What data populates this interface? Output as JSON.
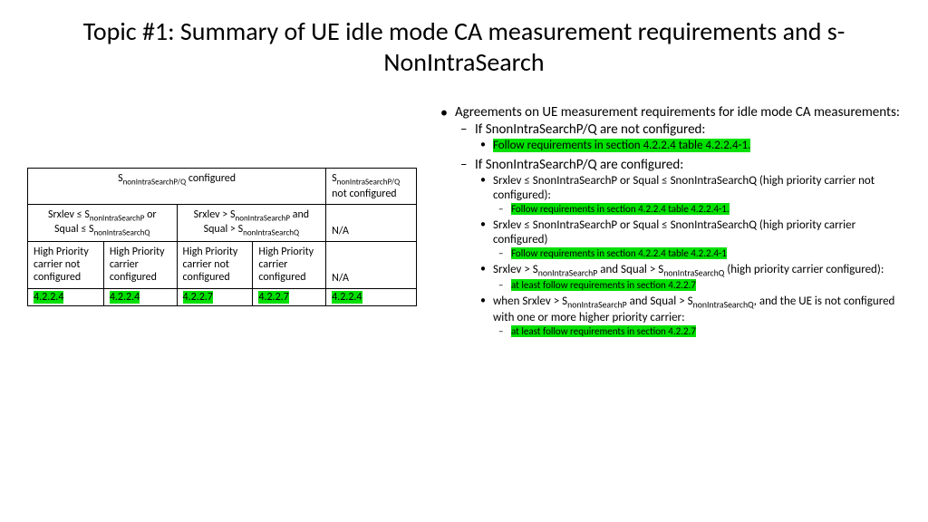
{
  "title": "Topic #1: Summary of UE idle mode CA measurement requirements and s-NonIntraSearch",
  "table": {
    "h_configured_pre": "S",
    "h_configured_sub": "nonIntraSearchP/Q",
    "h_configured_post": " configured",
    "h_notconf_pre": "S",
    "h_notconf_sub": "nonIntraSearchP/Q",
    "h_notconf_post": " not configured",
    "cond1_l1_pre": "Srxlev ≤ S",
    "cond1_l1_sub": "nonIntraSearchP",
    "cond1_l1_post": " or",
    "cond1_l2_pre": "Squal ≤ S",
    "cond1_l2_sub": "nonIntraSearchQ",
    "cond2_l1_pre": "Srxlev > S",
    "cond2_l1_sub": "nonIntraSearchP",
    "cond2_l1_post": " and",
    "cond2_l2_pre": "Squal > S",
    "cond2_l2_sub": "nonIntraSearchQ",
    "na": "N/A",
    "c1": "High Priority carrier not configured",
    "c2": "High Priority carrier configured",
    "c3": "High Priority carrier not configured",
    "c4": "High Priority carrier configured",
    "v1": "4.2.2.4",
    "v2": "4.2.2.4",
    "v3": "4.2.2.7",
    "v4": "4.2.2.7",
    "v5": "4.2.2.4"
  },
  "bul": {
    "a": "Agreements on UE measurement requirements for idle mode CA measurements:",
    "b1": "If SnonIntraSearchP/Q are not configured:",
    "b1a": "Follow requirements in section 4.2.2.4 table 4.2.2.4-1.",
    "b2": "If SnonIntraSearchP/Q are configured:",
    "b2a": "Srxlev ≤ SnonIntraSearchP or Squal ≤ SnonIntraSearchQ (high priority carrier not configured):",
    "b2a1": "Follow requirements in section 4.2.2.4 table 4.2.2.4-1.",
    "b2b": "Srxlev ≤ SnonIntraSearchP or Squal ≤ SnonIntraSearchQ (high priority carrier configured)",
    "b2b1": "Follow requirements in section 4.2.2.4 table 4.2.2.4-1",
    "b2c_pre": "Srxlev > S",
    "b2c_sub1": "nonIntraSearchP",
    "b2c_mid": " and Squal > S",
    "b2c_sub2": "nonIntraSearchQ",
    "b2c_post": " (high priority carrier configured):",
    "b2c1": "at least follow requirements in section 4.2.2.7",
    "b2d_pre": "when Srxlev > S",
    "b2d_sub1": "nonIntraSearchP",
    "b2d_mid": " and Squal > S",
    "b2d_sub2": "nonIntraSearchQ",
    "b2d_post": ", and the UE is not configured with one or more higher priority carrier:",
    "b2d1": "at least follow requirements in section 4.2.2.7"
  }
}
